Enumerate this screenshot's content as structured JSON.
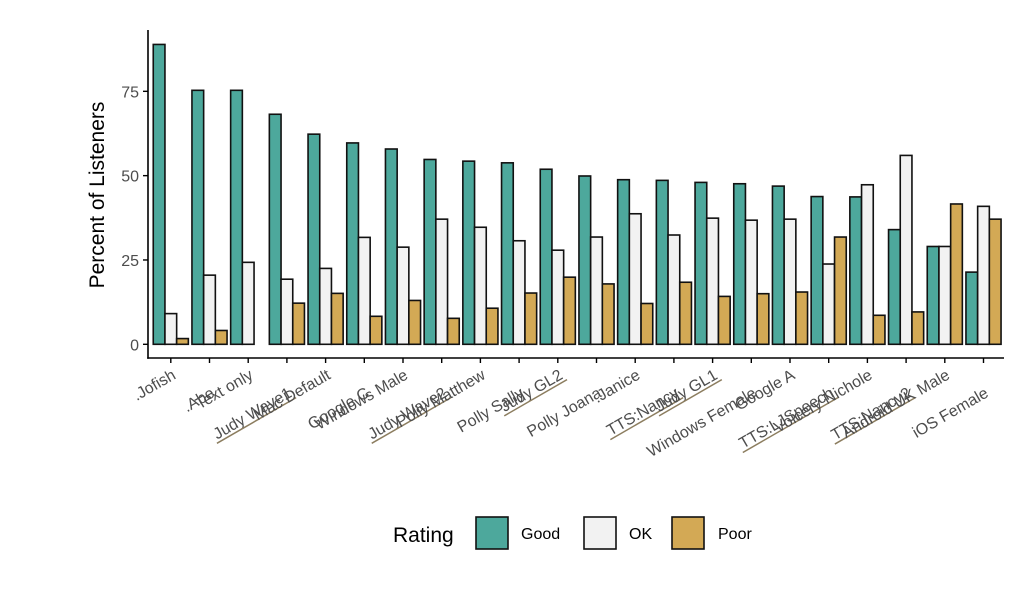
{
  "chart_data": {
    "type": "bar",
    "title": "",
    "xlabel": "",
    "ylabel": "Percent of Listeners",
    "ylim": [
      0,
      93
    ],
    "yticks": [
      0,
      25,
      50,
      75
    ],
    "grid": false,
    "legend": {
      "title": "Rating",
      "placement": "bottom",
      "entries": [
        "Good",
        "OK",
        "Poor"
      ]
    },
    "colors": {
      "Good": "#4DA89C",
      "OK": "#F2F2F2",
      "Poor": "#D3A955",
      "underline": "#8C7D5F"
    },
    "categories": [
      ".Jofish",
      ".Abe",
      "Text only",
      "Judy Wave1",
      "Mac Default",
      "Google C",
      "Windows Male",
      "Judy Wave2",
      "Polly Matthew",
      "Polly Sally",
      "Judy GL2",
      "Polly Joana",
      ".Janice",
      "TTS:Nancy",
      "Judy GL1",
      "Windows Female",
      "Google A",
      "TTS:LJSpeech",
      "Voicery Nichole",
      "TTS:Nancy2",
      "Android UK Male",
      "iOS Female"
    ],
    "underlined_categories": [
      "Judy Wave1",
      "Judy Wave2",
      "Judy GL2",
      "TTS:Nancy",
      "Judy GL1",
      "TTS:LJSpeech",
      "TTS:Nancy2"
    ],
    "series": [
      {
        "name": "Good",
        "values": [
          88.9,
          75.3,
          75.3,
          68.2,
          62.3,
          59.7,
          57.9,
          54.8,
          54.3,
          53.8,
          51.9,
          49.9,
          48.8,
          48.6,
          48.0,
          47.6,
          46.9,
          43.8,
          43.7,
          34.0,
          29.0,
          21.4
        ]
      },
      {
        "name": "OK",
        "values": [
          9.1,
          20.5,
          24.3,
          19.3,
          22.5,
          31.7,
          28.8,
          37.1,
          34.7,
          30.7,
          27.9,
          31.8,
          38.7,
          32.4,
          37.4,
          36.8,
          37.1,
          23.8,
          47.3,
          56.0,
          29.0,
          40.9
        ]
      },
      {
        "name": "Poor",
        "values": [
          1.7,
          4.1,
          0,
          12.2,
          15.1,
          8.3,
          13.0,
          7.7,
          10.7,
          15.2,
          19.9,
          17.9,
          12.1,
          18.4,
          14.2,
          15.0,
          15.5,
          31.8,
          8.6,
          9.6,
          41.6,
          37.1
        ]
      }
    ]
  }
}
